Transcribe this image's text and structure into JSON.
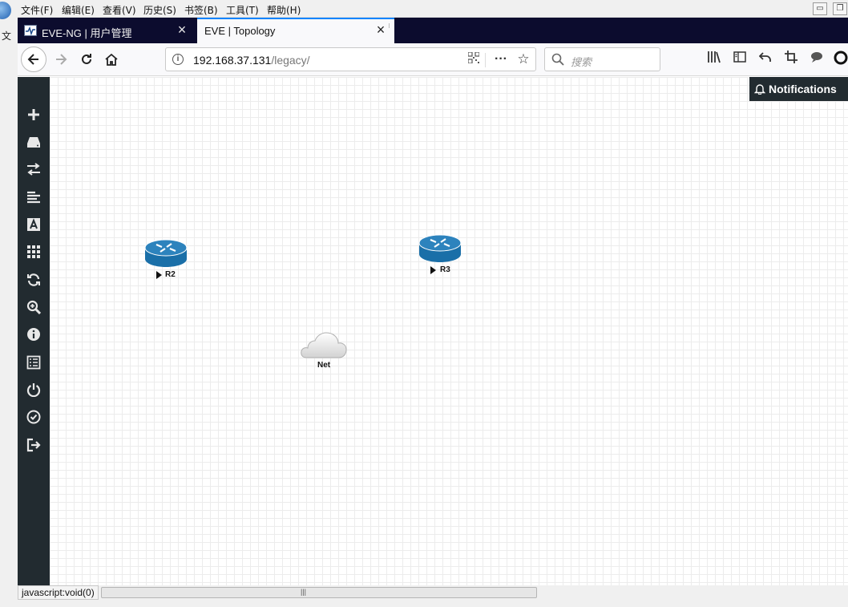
{
  "menubar": {
    "items": [
      "文件(F)",
      "编辑(E)",
      "查看(V)",
      "历史(S)",
      "书签(B)",
      "工具(T)",
      "帮助(H)"
    ]
  },
  "desktop": {
    "edge_text": "文"
  },
  "tabs": [
    {
      "title": "EVE-NG | 用户管理",
      "active": false
    },
    {
      "title": "EVE | Topology",
      "active": true
    }
  ],
  "urlbar": {
    "host": "192.168.37.131",
    "path": "/legacy/"
  },
  "search": {
    "placeholder": "搜索"
  },
  "sidebar": {
    "icons": [
      "plus-icon",
      "drive-icon",
      "exchange-icon",
      "align-left-icon",
      "text-icon",
      "grid-icon",
      "refresh-icon",
      "zoom-icon",
      "info-icon",
      "list-icon",
      "power-icon",
      "check-circle-icon",
      "sign-out-icon"
    ]
  },
  "notifications": {
    "label": "Notifications"
  },
  "topology": {
    "nodes": [
      {
        "name": "R2",
        "type": "router"
      },
      {
        "name": "R3",
        "type": "router"
      },
      {
        "name": "Net",
        "type": "cloud"
      }
    ]
  },
  "statusbar": {
    "text": "javascript:void(0)"
  },
  "colors": {
    "sidebar": "#222b30",
    "router": "#1a6fa8",
    "tab_bar": "#0c0c2e",
    "active_tab_accent": "#0a84ff"
  }
}
